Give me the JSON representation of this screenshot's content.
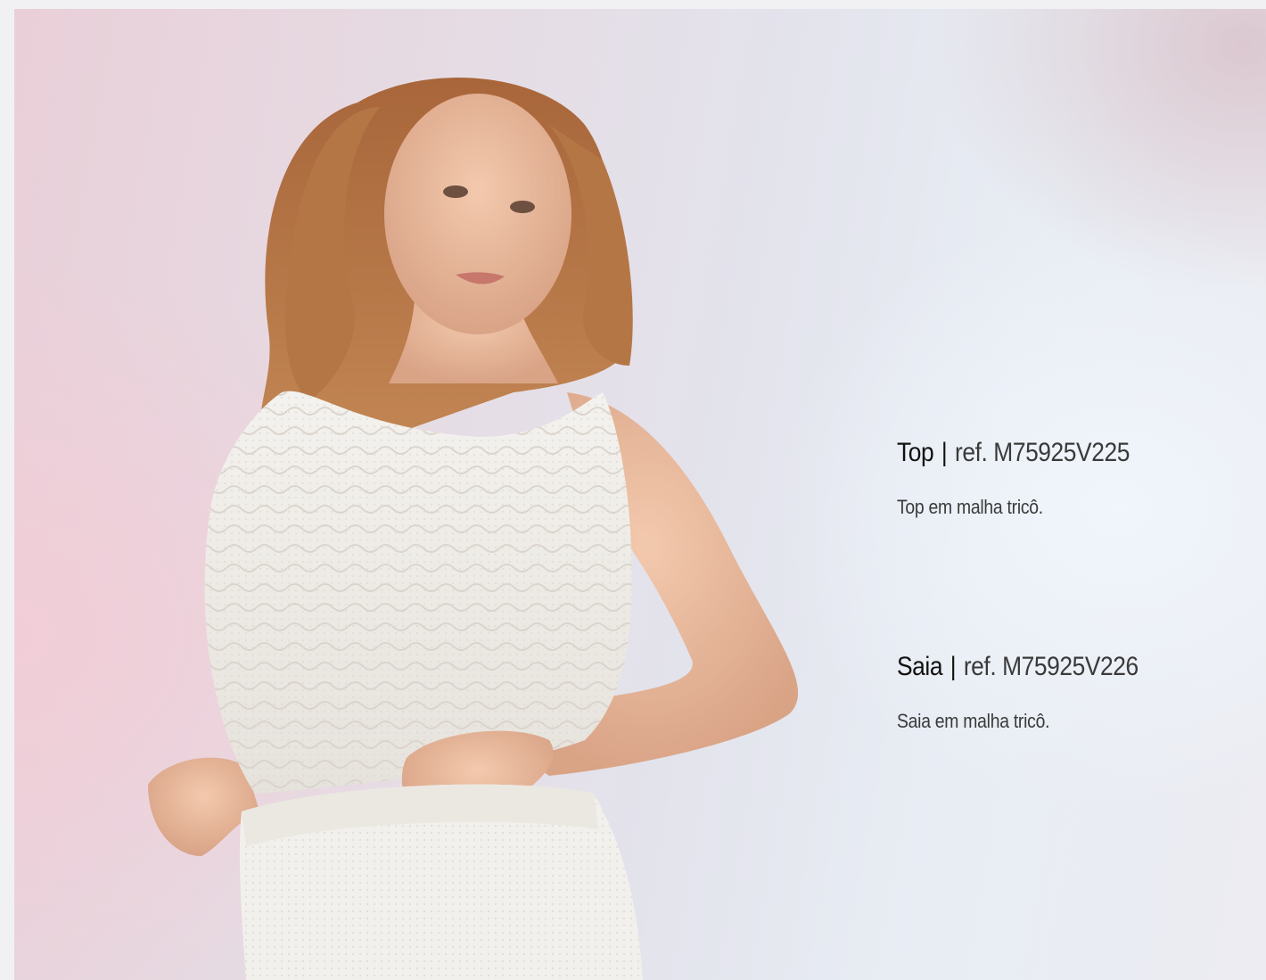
{
  "colors": {
    "page_background": "#f1f1f3",
    "heading_text": "#111111",
    "body_text": "#3a3a3a"
  },
  "products": [
    {
      "name": "Top",
      "separator": "|",
      "ref": "ref. M75925V225",
      "description": "Top em malha tricô."
    },
    {
      "name": "Saia",
      "separator": "|",
      "ref": "ref. M75925V226",
      "description": "Saia em malha tricô."
    }
  ]
}
